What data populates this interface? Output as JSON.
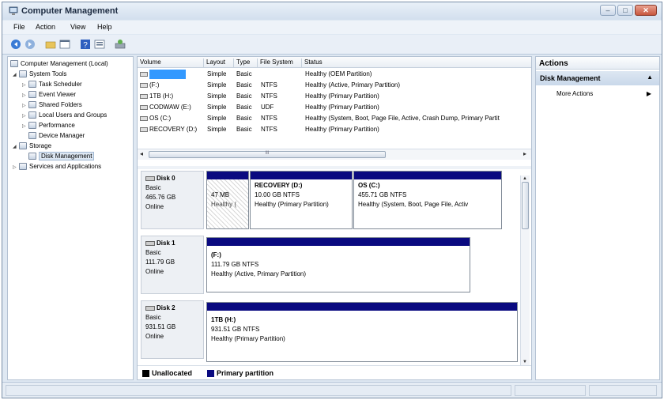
{
  "window": {
    "title": "Computer Management"
  },
  "menu": [
    "File",
    "Action",
    "View",
    "Help"
  ],
  "tree": [
    {
      "label": "Computer Management (Local)",
      "icon": "computer-icon",
      "level": 0,
      "expander": ""
    },
    {
      "label": "System Tools",
      "icon": "tools-icon",
      "level": 1,
      "expander": "◢"
    },
    {
      "label": "Task Scheduler",
      "icon": "clock-icon",
      "level": 2,
      "expander": "▷"
    },
    {
      "label": "Event Viewer",
      "icon": "event-icon",
      "level": 2,
      "expander": "▷"
    },
    {
      "label": "Shared Folders",
      "icon": "folder-icon",
      "level": 2,
      "expander": "▷"
    },
    {
      "label": "Local Users and Groups",
      "icon": "users-icon",
      "level": 2,
      "expander": "▷"
    },
    {
      "label": "Performance",
      "icon": "performance-icon",
      "level": 2,
      "expander": "▷"
    },
    {
      "label": "Device Manager",
      "icon": "device-icon",
      "level": 2,
      "expander": ""
    },
    {
      "label": "Storage",
      "icon": "storage-icon",
      "level": 1,
      "expander": "◢"
    },
    {
      "label": "Disk Management",
      "icon": "disk-icon",
      "level": 2,
      "expander": "",
      "selected": true
    },
    {
      "label": "Services and Applications",
      "icon": "services-icon",
      "level": 1,
      "expander": "▷"
    }
  ],
  "volumes": {
    "columns": [
      "Volume",
      "Layout",
      "Type",
      "File System",
      "Status"
    ],
    "rows": [
      {
        "volume": "",
        "layout": "Simple",
        "type": "Basic",
        "fs": "",
        "status": "Healthy (OEM Partition)",
        "selected": true
      },
      {
        "volume": "(F:)",
        "layout": "Simple",
        "type": "Basic",
        "fs": "NTFS",
        "status": "Healthy (Active, Primary Partition)"
      },
      {
        "volume": "1TB (H:)",
        "layout": "Simple",
        "type": "Basic",
        "fs": "NTFS",
        "status": "Healthy (Primary Partition)"
      },
      {
        "volume": "CODWAW (E:)",
        "layout": "Simple",
        "type": "Basic",
        "fs": "UDF",
        "status": "Healthy (Primary Partition)"
      },
      {
        "volume": "OS (C:)",
        "layout": "Simple",
        "type": "Basic",
        "fs": "NTFS",
        "status": "Healthy (System, Boot, Page File, Active, Crash Dump, Primary Partit"
      },
      {
        "volume": "RECOVERY (D:)",
        "layout": "Simple",
        "type": "Basic",
        "fs": "NTFS",
        "status": "Healthy (Primary Partition)"
      }
    ],
    "scroll_thumb_glyph": "III"
  },
  "disks": [
    {
      "name": "Disk 0",
      "type": "Basic",
      "size": "465.76 GB",
      "state": "Online",
      "partitions": [
        {
          "title": "",
          "line1": "47 MB",
          "line2": "Healthy (",
          "hatched": true
        },
        {
          "title": "RECOVERY  (D:)",
          "line1": "10.00 GB NTFS",
          "line2": "Healthy (Primary Partition)"
        },
        {
          "title": "OS  (C:)",
          "line1": "455.71 GB NTFS",
          "line2": "Healthy (System, Boot, Page File, Activ"
        }
      ]
    },
    {
      "name": "Disk 1",
      "type": "Basic",
      "size": "111.79 GB",
      "state": "Online",
      "partitions": [
        {
          "title": "(F:)",
          "line1": "111.79 GB NTFS",
          "line2": "Healthy (Active, Primary Partition)"
        }
      ]
    },
    {
      "name": "Disk 2",
      "type": "Basic",
      "size": "931.51 GB",
      "state": "Online",
      "partitions": [
        {
          "title": "1TB  (H:)",
          "line1": "931.51 GB NTFS",
          "line2": "Healthy (Primary Partition)"
        }
      ]
    }
  ],
  "legend": [
    {
      "label": "Unallocated",
      "color": "#000000"
    },
    {
      "label": "Primary partition",
      "color": "#0a0a80"
    }
  ],
  "actions": {
    "header": "Actions",
    "section": "Disk Management",
    "items": [
      "More Actions"
    ]
  }
}
